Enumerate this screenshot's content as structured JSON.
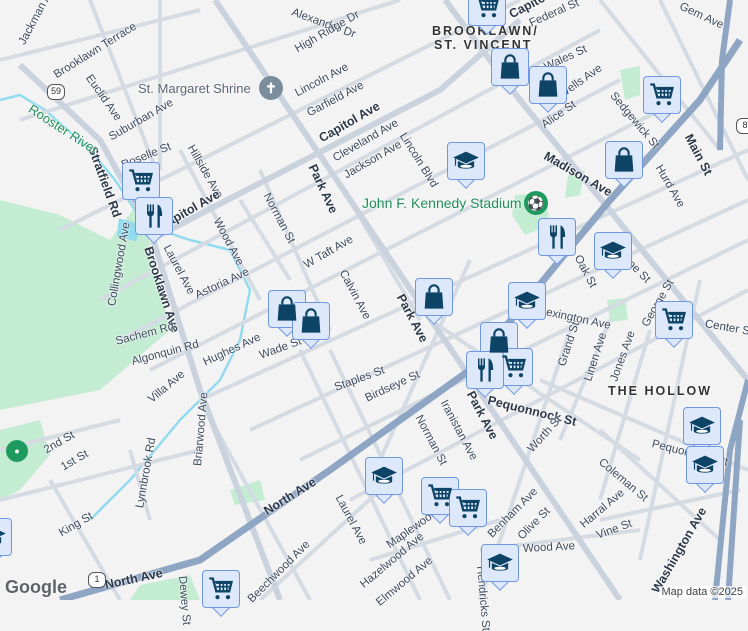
{
  "map": {
    "attribution": "Map data ©2025",
    "logo": "Google",
    "route_shields": [
      "59",
      "1",
      "8"
    ]
  },
  "colors": {
    "marker_bg": "#dde8fb",
    "marker_border": "#6f97e0",
    "icon": "#0d4466",
    "park": "#c4ecd3",
    "water": "#92dbee",
    "highway": "#8ea6c4"
  },
  "pois": {
    "shrine": "St. Margaret Shrine",
    "stadium": "John F. Kennedy Stadium",
    "river": "Rooster River"
  },
  "neighborhoods": {
    "brooklawn_1": "BROOKLAWN/",
    "brooklawn_2": "ST. VINCENT",
    "hollow": "THE HOLLOW"
  },
  "streets": [
    "Capitol Ave",
    "Federal St",
    "Gem Ave",
    "Lincoln Ave",
    "Garfield Ave",
    "Capitol Ave",
    "Cleveland Ave",
    "Jackson Ave",
    "Lincoln Blvd",
    "Madison Ave",
    "Alice St",
    "Sedgewick St",
    "Main St",
    "Hurd Ave",
    "Brooklawn Terrace",
    "Euclid Ave",
    "Suburban Ave",
    "Roselle St",
    "Stratfield Rd",
    "Hillside Ave",
    "Norman St",
    "Park Ave",
    "W Taft Ave",
    "Calvin Ave",
    "Park Ave",
    "Wood Ave",
    "Laurel Ave",
    "Capitol Ave",
    "Brooklawn Ave",
    "Collingwood Ave",
    "Astoria Ave",
    "Sachem Rd",
    "Algonquin Rd",
    "Hughes Ave",
    "Wade St",
    "Villa Ave",
    "Staples St",
    "Birdseye St",
    "Norman St",
    "Iranistan Ave",
    "Park Ave",
    "Lexington Ave",
    "Center St",
    "Grand St",
    "Linen Ave",
    "Jones Ave",
    "Pequonnock St",
    "Worth St",
    "Pequonnock St",
    "Coleman St",
    "Harral Ave",
    "Vine St",
    "Olive St",
    "Benham Ave",
    "Wood Ave",
    "Washington Ave",
    "Maplewood",
    "Hazelwood Ave",
    "Elmwood Ave",
    "North Ave",
    "North Ave",
    "Laurel Ave",
    "Briarwood Ave",
    "Lynnbrook Rd",
    "2nd St",
    "1st St",
    "King St",
    "Beechwood Ave",
    "Catherine St",
    "Oak St",
    "George St",
    "Alexander Dr",
    "High Ridge Dr",
    "Jackman Ave",
    "Wales St",
    "Wells Ave",
    "Hendricks St",
    "Dewey St"
  ],
  "markers": [
    "grocery",
    "shopping",
    "shopping",
    "grocery",
    "school",
    "shopping",
    "restaurant",
    "school",
    "shopping",
    "school",
    "grocery",
    "shopping",
    "shopping",
    "shopping",
    "grocery",
    "restaurant",
    "school",
    "school",
    "school",
    "grocery",
    "grocery",
    "school",
    "grocery",
    "grocery",
    "restaurant",
    "school"
  ]
}
